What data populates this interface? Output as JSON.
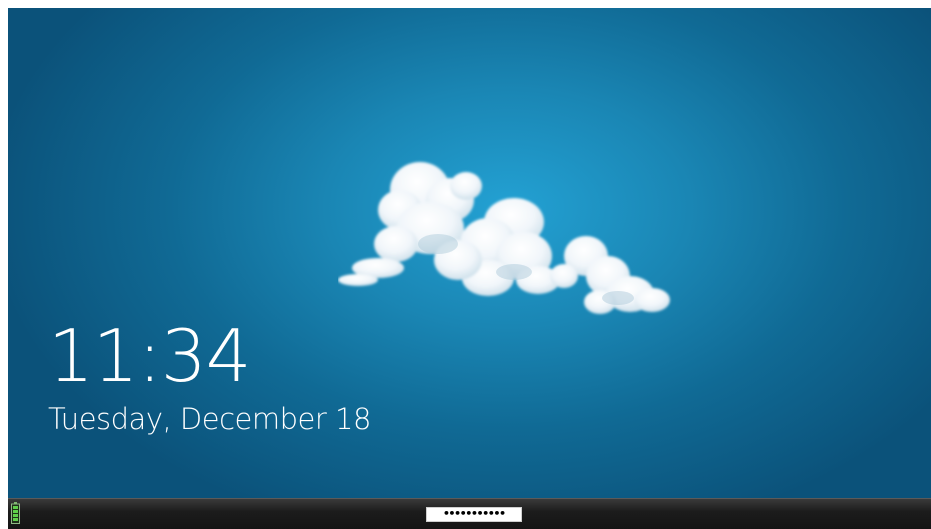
{
  "lock_screen": {
    "time": "11:34",
    "date": "Tuesday, December 18",
    "wallpaper": {
      "subject": "cloud-icon",
      "colors": {
        "center": "#23a1d3",
        "edge": "#0b527a"
      }
    }
  },
  "taskbar": {
    "battery_icon": "battery-icon",
    "password_value": "•••••••••••",
    "colors": {
      "background": "#1c1c1c",
      "battery": "#5fd04a"
    }
  }
}
